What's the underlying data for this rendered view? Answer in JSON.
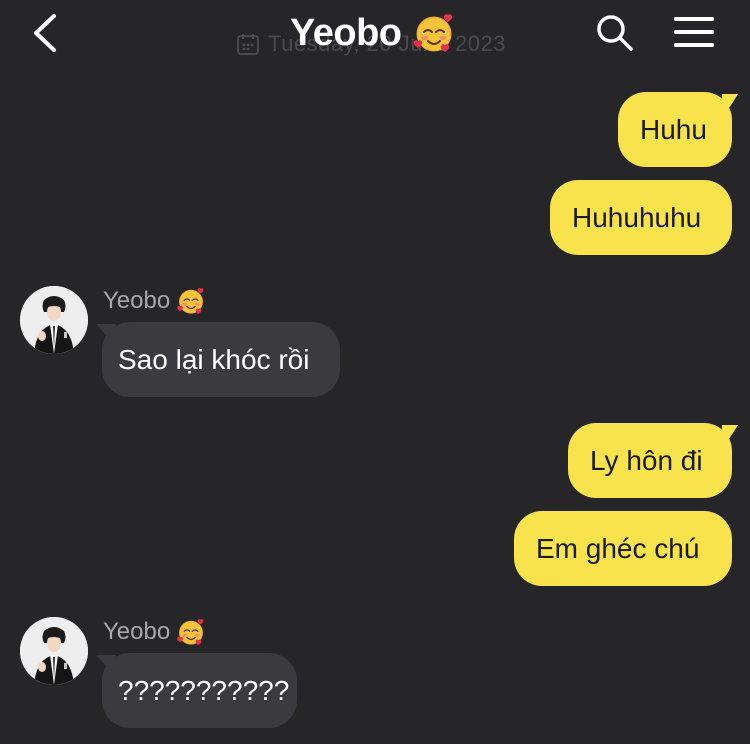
{
  "header": {
    "title": "Yeobo",
    "title_emoji": "smiling-face-with-hearts",
    "date_watermark": "Tuesday, 20 June 2023",
    "back_icon": "chevron-left-icon",
    "search_icon": "search-icon",
    "menu_icon": "hamburger-menu-icon"
  },
  "colors": {
    "background": "#262629",
    "outgoing_bubble": "#f9e34c",
    "incoming_bubble": "#3b3b3f",
    "sender_name": "#a7a7ac"
  },
  "messages": [
    {
      "direction": "outgoing",
      "text": "Huhu"
    },
    {
      "direction": "outgoing",
      "text": "Huhuhuhu"
    },
    {
      "direction": "incoming",
      "sender": "Yeobo",
      "sender_emoji": "smiling-face-with-hearts",
      "text": "Sao lại khóc rồi"
    },
    {
      "direction": "outgoing",
      "text": "Ly hôn đi"
    },
    {
      "direction": "outgoing",
      "text": "Em ghéc chú"
    },
    {
      "direction": "incoming",
      "sender": "Yeobo",
      "sender_emoji": "smiling-face-with-hearts",
      "text": "???????????"
    }
  ]
}
